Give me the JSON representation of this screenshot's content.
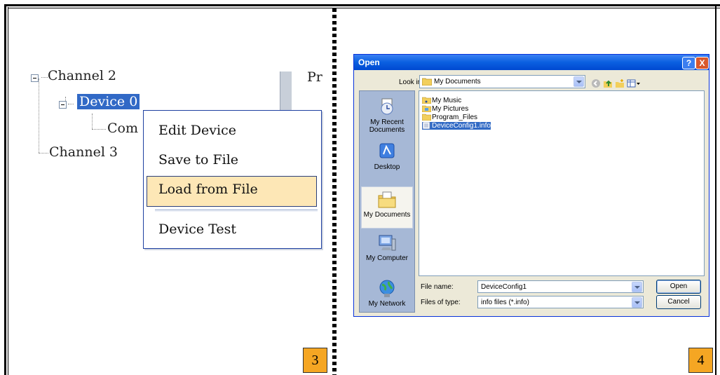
{
  "left_panel": {
    "tree": {
      "channel2": "Channel 2",
      "device0": "Device 0",
      "com_partial": "Com",
      "channel3": "Channel 3"
    },
    "truncated_right_text": "Pr",
    "context_menu": {
      "items": [
        "Edit Device",
        "Save to File",
        "Load from File",
        "Device Test"
      ],
      "highlighted_index": 2
    },
    "badge": "3"
  },
  "right_panel": {
    "badge": "4",
    "dialog": {
      "title": "Open",
      "look_in_label": "Look in:",
      "look_in_value": "My Documents",
      "places": [
        "My Recent Documents",
        "Desktop",
        "My Documents",
        "My Computer",
        "My Network"
      ],
      "active_place_index": 2,
      "files": [
        "My Music",
        "My Pictures",
        "Program_Files",
        "DeviceConfig1.info"
      ],
      "selected_file_index": 3,
      "file_name_label": "File name:",
      "file_name_value": "DeviceConfig1",
      "files_of_type_label": "Files of type:",
      "files_of_type_value": "info files (*.info)",
      "open_button": "Open",
      "cancel_button": "Cancel",
      "help_button": "?",
      "close_button": "X"
    }
  },
  "colors": {
    "selection_blue": "#316ac5",
    "menu_highlight": "#fde7b6",
    "badge_orange": "#f5a623",
    "xp_title_blue": "#0a5fe0"
  }
}
